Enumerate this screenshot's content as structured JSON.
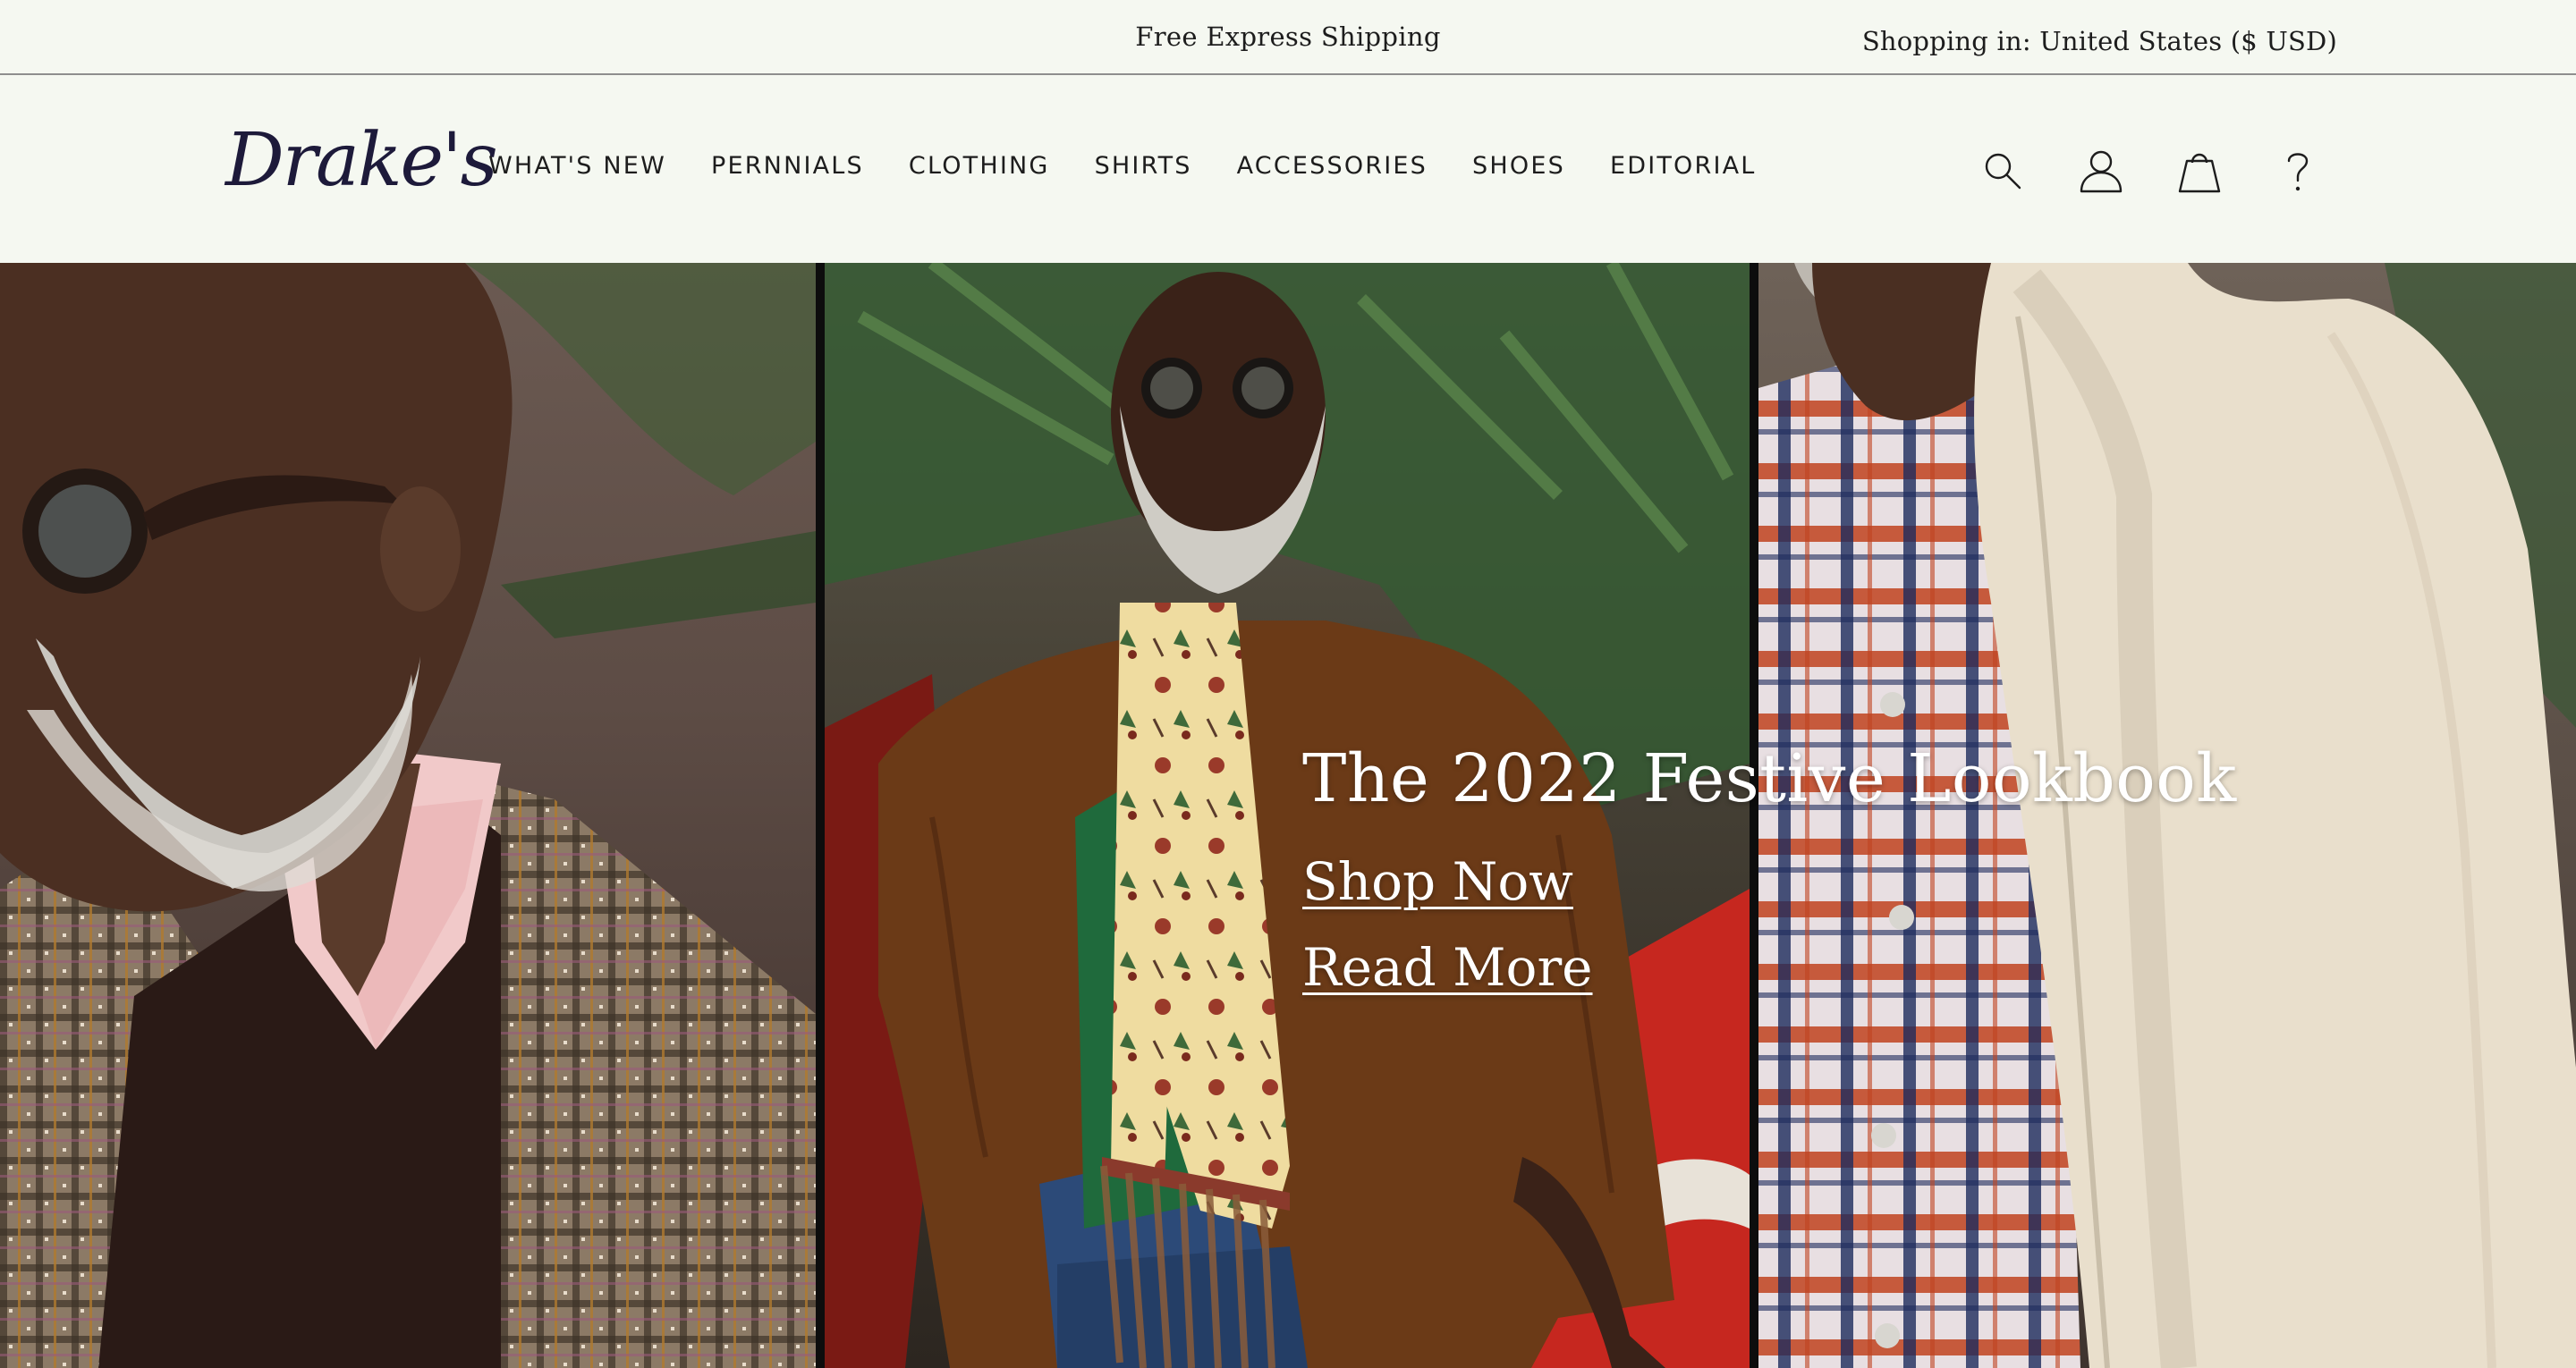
{
  "announcement": {
    "text": "Free Express Shipping",
    "locale": "Shopping in: United States ($ USD)"
  },
  "header": {
    "logo": "Drake's",
    "nav": [
      {
        "label": "WHAT'S NEW"
      },
      {
        "label": "PERNNIALS"
      },
      {
        "label": "CLOTHING"
      },
      {
        "label": "SHIRTS"
      },
      {
        "label": "ACCESSORIES"
      },
      {
        "label": "SHOES"
      },
      {
        "label": "EDITORIAL"
      }
    ],
    "icons": [
      "search-icon",
      "account-icon",
      "bag-icon",
      "help-icon"
    ]
  },
  "hero": {
    "title": "The 2022 Festive Lookbook",
    "shop_link": "Shop Now",
    "read_link": "Read More"
  },
  "colors": {
    "background": "#f5f8f1",
    "logo": "#1d1a3a",
    "text": "#1d1d1d",
    "hero_text": "#ffffff"
  }
}
